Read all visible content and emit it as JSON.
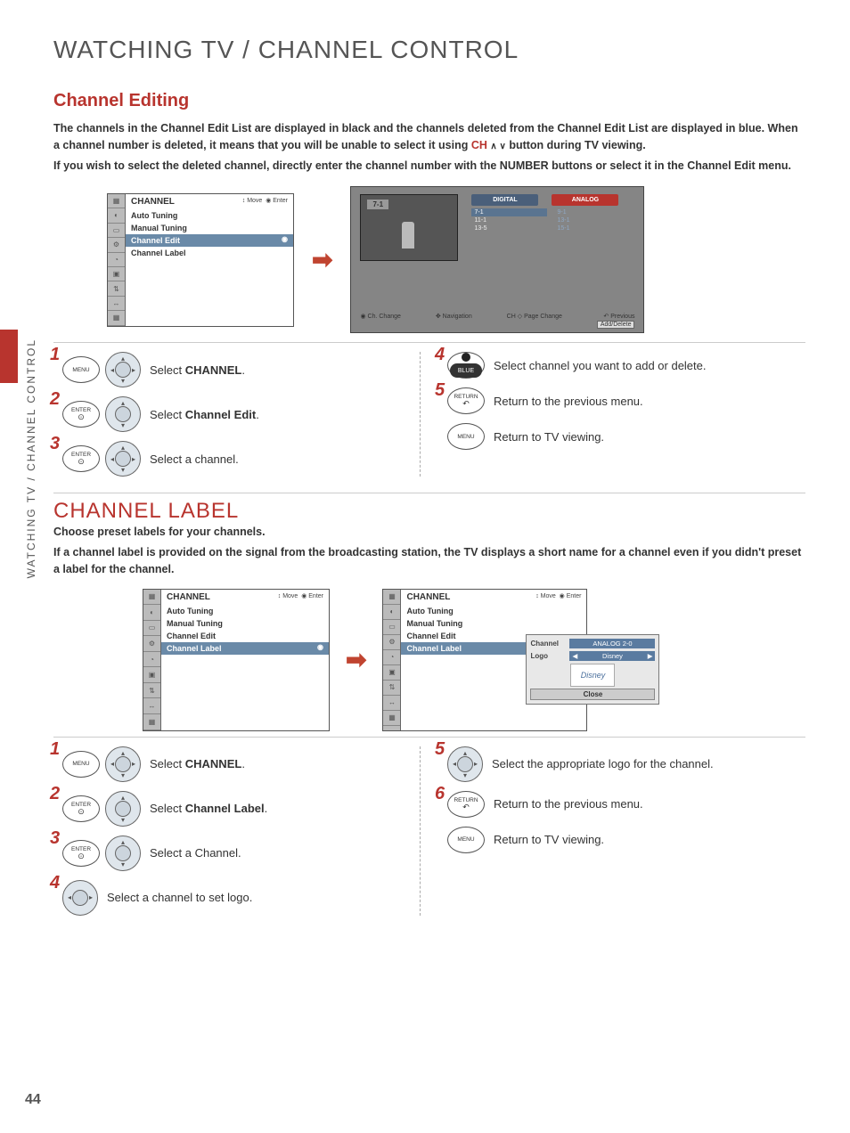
{
  "page_number": "44",
  "side_label": "WATCHING TV / CHANNEL CONTROL",
  "main_title": "WATCHING TV / CHANNEL CONTROL",
  "section1": {
    "title": "Channel Editing",
    "para1": "The channels in the Channel Edit List are displayed in black and the channels deleted from the Channel Edit List are displayed in blue. When a channel number is deleted, it means that you will be unable to select it using",
    "ch_label": "CH",
    "para1b": "button during TV viewing.",
    "para2a": "If you wish to select the deleted channel, directly enter the channel number with the NUMBER buttons or select it in the",
    "para2b": "Channel Edit",
    "para2c": "menu."
  },
  "menu_screen": {
    "header": "CHANNEL",
    "hints_move": "Move",
    "hints_enter": "Enter",
    "items": [
      "Auto Tuning",
      "Manual Tuning",
      "Channel Edit",
      "Channel Label"
    ],
    "selected": 2
  },
  "edit_screen": {
    "current": "7-1",
    "tab_digital": "DIGITAL",
    "tab_analog": "ANALOG",
    "digital_list": [
      "7-1",
      "11-1",
      "13-5"
    ],
    "analog_list": [
      "9-1",
      "13-1",
      "15-1"
    ],
    "footer": {
      "ch_change": "Ch. Change",
      "nav": "Navigation",
      "page": "Page Change",
      "ch_lbl": "CH",
      "prev": "Previous",
      "add": "Add/Delete"
    }
  },
  "steps1_left": [
    {
      "n": "1",
      "btn": "MENU",
      "pad": "full",
      "text_pre": "Select ",
      "bold": "CHANNEL",
      "text_post": "."
    },
    {
      "n": "2",
      "btn": "ENTER",
      "sub": "⊙",
      "pad": "ud",
      "text_pre": "Select ",
      "bold": "Channel Edit",
      "text_post": "."
    },
    {
      "n": "3",
      "btn": "ENTER",
      "sub": "⊙",
      "pad": "full",
      "text_pre": "Select a channel.",
      "bold": "",
      "text_post": ""
    }
  ],
  "steps1_right": [
    {
      "n": "4",
      "btn": "BLUE",
      "pad": "",
      "text_pre": "Select channel you want to add or delete.",
      "bold": "",
      "text_post": ""
    },
    {
      "n": "5",
      "btn": "RETURN",
      "pad": "",
      "sub": "↶",
      "text_pre": "Return to the previous menu.",
      "bold": "",
      "text_post": ""
    },
    {
      "n": "",
      "btn": "MENU",
      "pad": "",
      "text_pre": "Return to TV viewing.",
      "bold": "",
      "text_post": ""
    }
  ],
  "section2": {
    "title": "CHANNEL LABEL",
    "para1": "Choose preset labels for your channels.",
    "para2": "If a channel label is provided on the signal from the broadcasting station, the TV displays a short name for a channel even if you didn't preset a label for the channel."
  },
  "menu_screen2": {
    "header": "CHANNEL",
    "items": [
      "Auto Tuning",
      "Manual Tuning",
      "Channel Edit",
      "Channel Label"
    ],
    "selected": 3
  },
  "label_popup": {
    "channel_lbl": "Channel",
    "channel_val": "ANALOG 2-0",
    "logo_lbl": "Logo",
    "logo_val": "Disney",
    "close": "Close"
  },
  "steps2_left": [
    {
      "n": "1",
      "btn": "MENU",
      "pad": "full",
      "text_pre": "Select ",
      "bold": "CHANNEL",
      "text_post": "."
    },
    {
      "n": "2",
      "btn": "ENTER",
      "sub": "⊙",
      "pad": "ud",
      "text_pre": "Select ",
      "bold": "Channel Label",
      "text_post": "."
    },
    {
      "n": "3",
      "btn": "ENTER",
      "sub": "⊙",
      "pad": "ud",
      "text_pre": "Select a Channel.",
      "bold": "",
      "text_post": ""
    },
    {
      "n": "4",
      "btn": "",
      "pad": "lr",
      "text_pre": "Select a channel to set logo.",
      "bold": "",
      "text_post": ""
    }
  ],
  "steps2_right": [
    {
      "n": "5",
      "btn": "",
      "pad": "quad",
      "text_pre": "Select the appropriate logo for the channel.",
      "bold": "",
      "text_post": ""
    },
    {
      "n": "6",
      "btn": "RETURN",
      "sub": "↶",
      "pad": "",
      "text_pre": "Return to the previous menu.",
      "bold": "",
      "text_post": ""
    },
    {
      "n": "",
      "btn": "MENU",
      "pad": "",
      "text_pre": "Return to TV viewing.",
      "bold": "",
      "text_post": ""
    }
  ]
}
